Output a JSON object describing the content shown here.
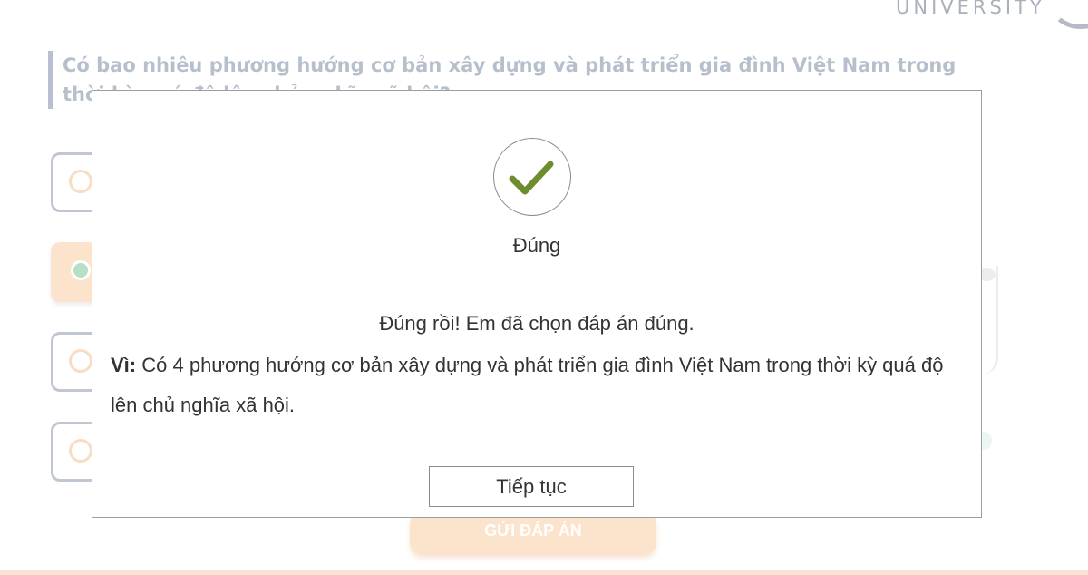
{
  "header": {
    "logo_text": "UNIVERSITY"
  },
  "quiz": {
    "question": "Có bao nhiêu phương hướng cơ bản xây dựng và phát triển gia đình Việt Nam trong thời kỳ quá độ lên chủ nghĩa xã hội?",
    "submit_label": "GỬI ĐÁP ÁN"
  },
  "modal": {
    "icon": "check-icon",
    "status": "Đúng",
    "message": "Đúng rồi! Em đã chọn đáp án đúng.",
    "explanation_label": "Vì:",
    "explanation": "Có 4 phương hướng cơ bản xây dựng và phát triển gia đình Việt Nam trong thời kỳ quá độ lên chủ nghĩa xã hội.",
    "continue_label": "Tiếp tục"
  },
  "colors": {
    "check": "#6e8d2f",
    "submit_bg": "#fce3cc",
    "question_text": "#b6bfcc"
  }
}
